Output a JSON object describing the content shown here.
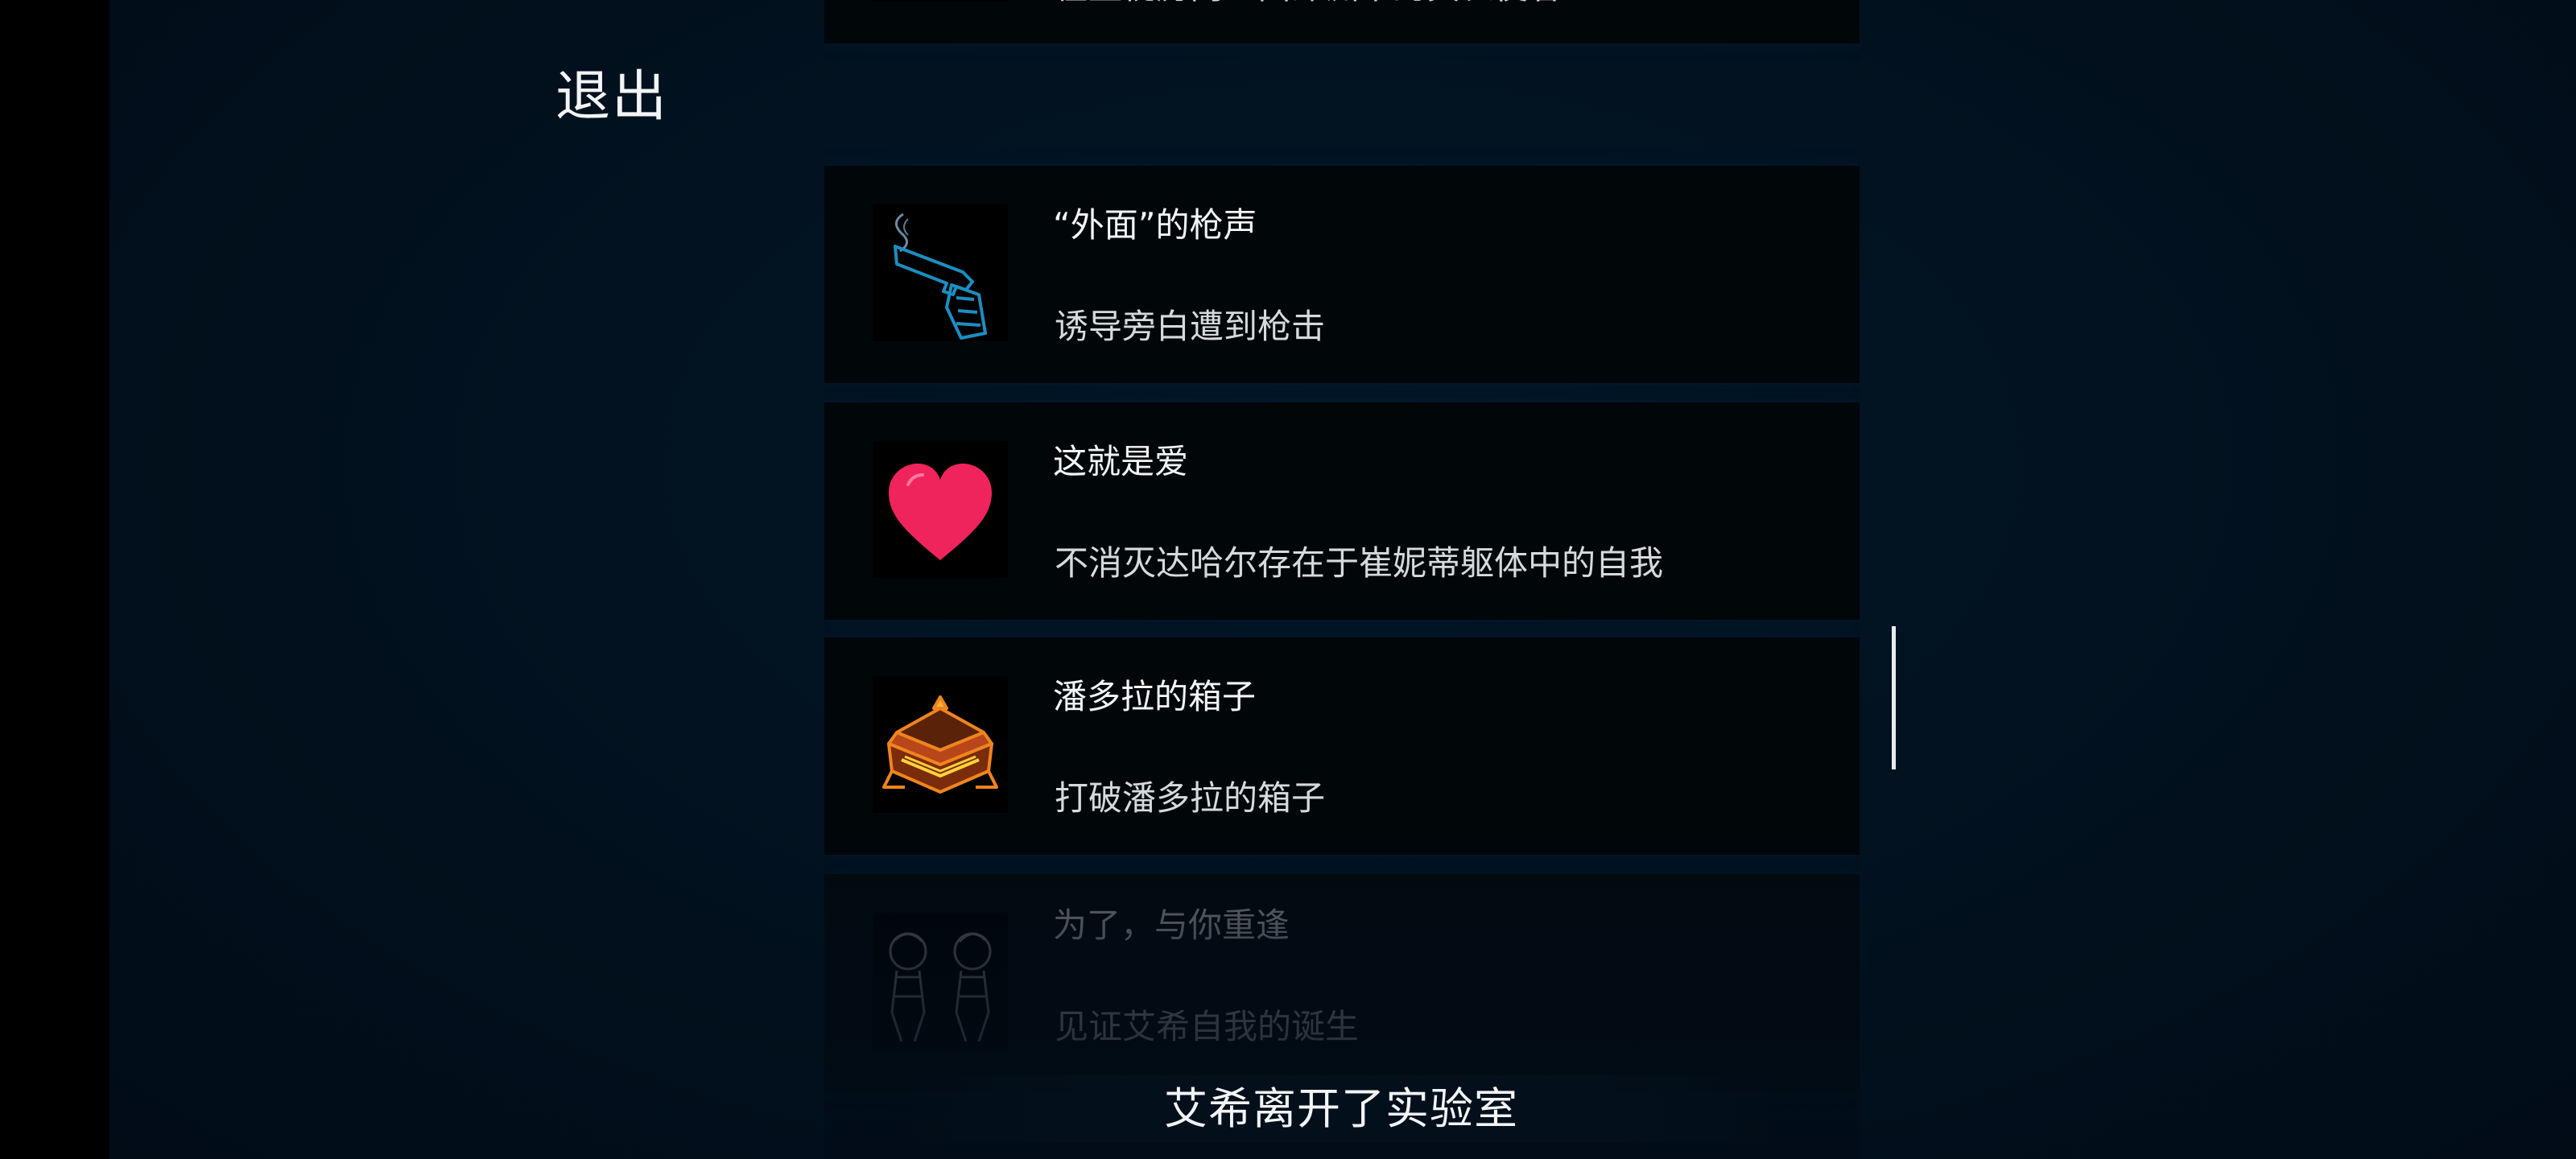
{
  "exit_label": "退出",
  "achievements": [
    {
      "title": "",
      "desc": "在监视房内直面深渊中的黄衣使者",
      "icon": "yellow-sign-icon",
      "locked": false
    },
    {
      "title": "“外面”的枪声",
      "desc": "诱导旁白遭到枪击",
      "icon": "pistol-icon",
      "locked": false
    },
    {
      "title": "这就是爱",
      "desc": "不消灭达哈尔存在于崔妮蒂躯体中的自我",
      "icon": "heart-icon",
      "locked": false
    },
    {
      "title": "潘多拉的箱子",
      "desc": "打破潘多拉的箱子",
      "icon": "box-icon",
      "locked": false
    },
    {
      "title": "为了，与你重逢",
      "desc": "见证艾希自我的诞生",
      "icon": "twin-figures-icon",
      "locked": true
    }
  ],
  "subtitle": "艾希离开了实验室",
  "colors": {
    "background": "#021220",
    "card": "#010609",
    "heart": "#f0245d",
    "gun": "#1b8ec2",
    "box": "#f0841e",
    "sign": "#e8cf43"
  }
}
